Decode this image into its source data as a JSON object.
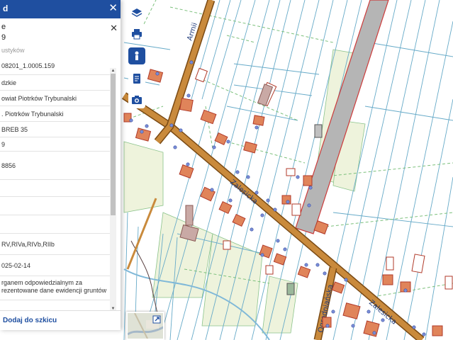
{
  "panel": {
    "header_title": "d",
    "close_glyph": "✕",
    "subclose_glyph": "✕",
    "title_line": "e",
    "title_value": "9",
    "subtitle": "ustyków",
    "rows": [
      "08201_1.0005.159",
      "dzkie",
      "owiat Piotrków Trybunalski",
      ". Piotrków Trybunalski",
      "BREB 35",
      "9",
      "8856",
      "",
      "",
      "",
      "RV,RIVa,RIVb,RIIb",
      "025-02-14",
      "rganem odpowiedzialnym za rezentowane dane ewidencji gruntów"
    ],
    "add_to_sketch": "Dodaj do szkicu"
  },
  "toolbar": [
    {
      "name": "layers-icon"
    },
    {
      "name": "print-icon"
    },
    {
      "name": "person-icon"
    },
    {
      "name": "notes-icon"
    },
    {
      "name": "camera-icon"
    }
  ],
  "map": {
    "street_labels": [
      "Armii",
      "Zalesicka",
      "Zalesicka",
      "Ogrodniańska"
    ],
    "colors": {
      "road_fill": "#c98a3c",
      "road_edge": "#7a4a14",
      "building": "#e0845a",
      "building_edge": "#b03a2a",
      "rail": "#b5b5b5",
      "field": "#eef3dc",
      "parcel_line": "#66aac8",
      "water": "#7fb8d8",
      "panel_blue": "#1f4fa0"
    }
  },
  "minimap": {
    "expand_icon": "expand-icon"
  }
}
